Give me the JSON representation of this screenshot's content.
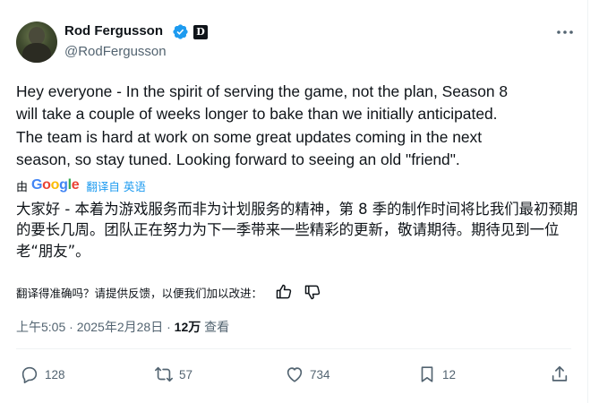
{
  "author": {
    "name": "Rod Fergusson",
    "handle": "@RodFergusson",
    "badge_letter": "D",
    "verified_color": "#1d9bf0"
  },
  "tweet": {
    "text": "Hey everyone - In the spirit of serving the game, not the plan, Season 8\nwill take a couple of weeks longer to bake than we initially anticipated.\nThe team is hard at work on some great updates coming in the next\nseason, so stay tuned. Looking forward to seeing an old \"friend\"."
  },
  "translation": {
    "by_label": "由",
    "google_logo": [
      "G",
      "o",
      "o",
      "g",
      "l",
      "e"
    ],
    "link_label": "翻译自 英语",
    "text": "大家好 - 本着为游戏服务而非为计划服务的精神，第 8 季的制作时间将比我们最初预期的要长几周。团队正在努力为下一季带来一些精彩的更新，敬请期待。期待见到一位老“朋友”。",
    "feedback_prompt": "翻译得准确吗？请提供反馈，以便我们加以改进："
  },
  "meta": {
    "time": "上午5:05",
    "date": "2025年2月28日",
    "separator": "·",
    "views_count": "12万",
    "views_label": "查看"
  },
  "actions": {
    "replies": "128",
    "reposts": "57",
    "likes": "734",
    "bookmarks": "12"
  },
  "colors": {
    "accent": "#1d9bf0",
    "secondary_text": "#536471",
    "primary_text": "#0f1419"
  }
}
